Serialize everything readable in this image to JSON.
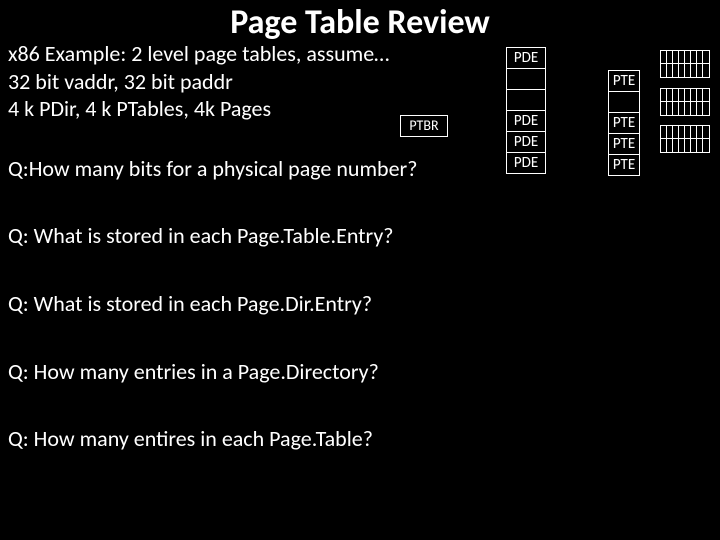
{
  "title": "Page Table Review",
  "intro": {
    "line1": "x86 Example: 2 level page tables, assume…",
    "line2": "32 bit vaddr, 32 bit paddr",
    "line3": "4 k PDir, 4 k PTables, 4k Pages"
  },
  "questions": {
    "q1": "Q:How many bits for a physical page number?",
    "q2": "Q: What is stored in each Page.Table.Entry?",
    "q3": "Q: What is stored in each Page.Dir.Entry?",
    "q4": "Q: How many entries in a Page.Directory?",
    "q5": "Q: How many entires in each Page.Table?"
  },
  "diagram": {
    "ptbr": "PTBR",
    "pde_rows": [
      "PDE",
      "",
      "",
      "PDE",
      "PDE",
      "PDE"
    ],
    "pte_rows": [
      "PTE",
      "",
      "PTE",
      "PTE",
      "PTE"
    ]
  }
}
